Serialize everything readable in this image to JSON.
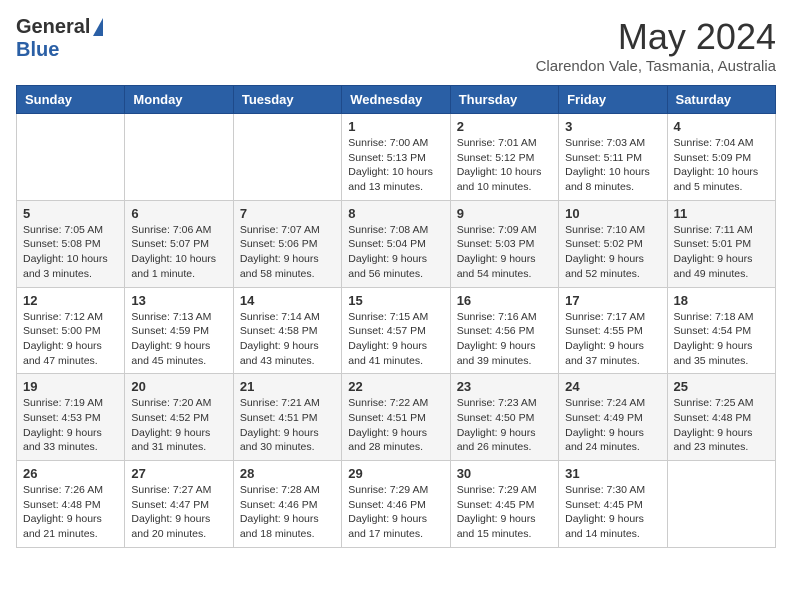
{
  "header": {
    "logo_general": "General",
    "logo_blue": "Blue",
    "month_title": "May 2024",
    "location": "Clarendon Vale, Tasmania, Australia"
  },
  "days_of_week": [
    "Sunday",
    "Monday",
    "Tuesday",
    "Wednesday",
    "Thursday",
    "Friday",
    "Saturday"
  ],
  "weeks": [
    [
      {
        "day": "",
        "content": ""
      },
      {
        "day": "",
        "content": ""
      },
      {
        "day": "",
        "content": ""
      },
      {
        "day": "1",
        "content": "Sunrise: 7:00 AM\nSunset: 5:13 PM\nDaylight: 10 hours\nand 13 minutes."
      },
      {
        "day": "2",
        "content": "Sunrise: 7:01 AM\nSunset: 5:12 PM\nDaylight: 10 hours\nand 10 minutes."
      },
      {
        "day": "3",
        "content": "Sunrise: 7:03 AM\nSunset: 5:11 PM\nDaylight: 10 hours\nand 8 minutes."
      },
      {
        "day": "4",
        "content": "Sunrise: 7:04 AM\nSunset: 5:09 PM\nDaylight: 10 hours\nand 5 minutes."
      }
    ],
    [
      {
        "day": "5",
        "content": "Sunrise: 7:05 AM\nSunset: 5:08 PM\nDaylight: 10 hours\nand 3 minutes."
      },
      {
        "day": "6",
        "content": "Sunrise: 7:06 AM\nSunset: 5:07 PM\nDaylight: 10 hours\nand 1 minute."
      },
      {
        "day": "7",
        "content": "Sunrise: 7:07 AM\nSunset: 5:06 PM\nDaylight: 9 hours\nand 58 minutes."
      },
      {
        "day": "8",
        "content": "Sunrise: 7:08 AM\nSunset: 5:04 PM\nDaylight: 9 hours\nand 56 minutes."
      },
      {
        "day": "9",
        "content": "Sunrise: 7:09 AM\nSunset: 5:03 PM\nDaylight: 9 hours\nand 54 minutes."
      },
      {
        "day": "10",
        "content": "Sunrise: 7:10 AM\nSunset: 5:02 PM\nDaylight: 9 hours\nand 52 minutes."
      },
      {
        "day": "11",
        "content": "Sunrise: 7:11 AM\nSunset: 5:01 PM\nDaylight: 9 hours\nand 49 minutes."
      }
    ],
    [
      {
        "day": "12",
        "content": "Sunrise: 7:12 AM\nSunset: 5:00 PM\nDaylight: 9 hours\nand 47 minutes."
      },
      {
        "day": "13",
        "content": "Sunrise: 7:13 AM\nSunset: 4:59 PM\nDaylight: 9 hours\nand 45 minutes."
      },
      {
        "day": "14",
        "content": "Sunrise: 7:14 AM\nSunset: 4:58 PM\nDaylight: 9 hours\nand 43 minutes."
      },
      {
        "day": "15",
        "content": "Sunrise: 7:15 AM\nSunset: 4:57 PM\nDaylight: 9 hours\nand 41 minutes."
      },
      {
        "day": "16",
        "content": "Sunrise: 7:16 AM\nSunset: 4:56 PM\nDaylight: 9 hours\nand 39 minutes."
      },
      {
        "day": "17",
        "content": "Sunrise: 7:17 AM\nSunset: 4:55 PM\nDaylight: 9 hours\nand 37 minutes."
      },
      {
        "day": "18",
        "content": "Sunrise: 7:18 AM\nSunset: 4:54 PM\nDaylight: 9 hours\nand 35 minutes."
      }
    ],
    [
      {
        "day": "19",
        "content": "Sunrise: 7:19 AM\nSunset: 4:53 PM\nDaylight: 9 hours\nand 33 minutes."
      },
      {
        "day": "20",
        "content": "Sunrise: 7:20 AM\nSunset: 4:52 PM\nDaylight: 9 hours\nand 31 minutes."
      },
      {
        "day": "21",
        "content": "Sunrise: 7:21 AM\nSunset: 4:51 PM\nDaylight: 9 hours\nand 30 minutes."
      },
      {
        "day": "22",
        "content": "Sunrise: 7:22 AM\nSunset: 4:51 PM\nDaylight: 9 hours\nand 28 minutes."
      },
      {
        "day": "23",
        "content": "Sunrise: 7:23 AM\nSunset: 4:50 PM\nDaylight: 9 hours\nand 26 minutes."
      },
      {
        "day": "24",
        "content": "Sunrise: 7:24 AM\nSunset: 4:49 PM\nDaylight: 9 hours\nand 24 minutes."
      },
      {
        "day": "25",
        "content": "Sunrise: 7:25 AM\nSunset: 4:48 PM\nDaylight: 9 hours\nand 23 minutes."
      }
    ],
    [
      {
        "day": "26",
        "content": "Sunrise: 7:26 AM\nSunset: 4:48 PM\nDaylight: 9 hours\nand 21 minutes."
      },
      {
        "day": "27",
        "content": "Sunrise: 7:27 AM\nSunset: 4:47 PM\nDaylight: 9 hours\nand 20 minutes."
      },
      {
        "day": "28",
        "content": "Sunrise: 7:28 AM\nSunset: 4:46 PM\nDaylight: 9 hours\nand 18 minutes."
      },
      {
        "day": "29",
        "content": "Sunrise: 7:29 AM\nSunset: 4:46 PM\nDaylight: 9 hours\nand 17 minutes."
      },
      {
        "day": "30",
        "content": "Sunrise: 7:29 AM\nSunset: 4:45 PM\nDaylight: 9 hours\nand 15 minutes."
      },
      {
        "day": "31",
        "content": "Sunrise: 7:30 AM\nSunset: 4:45 PM\nDaylight: 9 hours\nand 14 minutes."
      },
      {
        "day": "",
        "content": ""
      }
    ]
  ]
}
